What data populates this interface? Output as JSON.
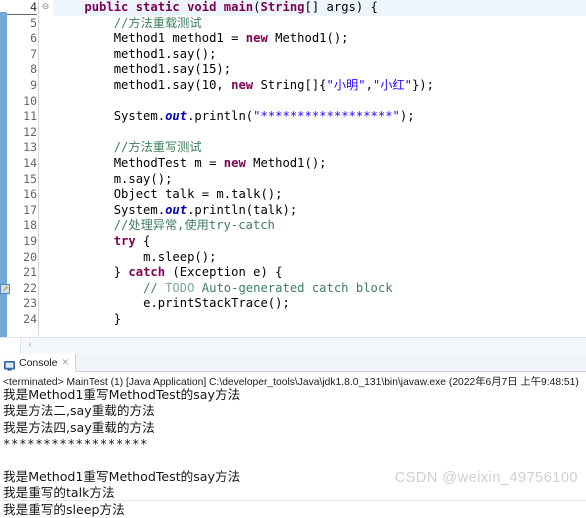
{
  "editor": {
    "first_line_number": 4,
    "current_line": 4,
    "fold_marker_glyph": "⊖",
    "warning_line": 22,
    "scroll_left_arrow": "‹",
    "lines": [
      {
        "n": 4,
        "indent": 1,
        "tokens": [
          {
            "t": "kw",
            "v": "public static void "
          },
          {
            "t": "kw",
            "v": "main"
          },
          {
            "t": "plain",
            "v": "("
          },
          {
            "t": "kw",
            "v": "String"
          },
          {
            "t": "plain",
            "v": "[] args) {"
          }
        ]
      },
      {
        "n": 5,
        "indent": 2,
        "tokens": [
          {
            "t": "cmt",
            "v": "//方法重载测试"
          }
        ]
      },
      {
        "n": 6,
        "indent": 2,
        "tokens": [
          {
            "t": "plain",
            "v": "Method1 method1 = "
          },
          {
            "t": "kw",
            "v": "new"
          },
          {
            "t": "plain",
            "v": " Method1();"
          }
        ]
      },
      {
        "n": 7,
        "indent": 2,
        "tokens": [
          {
            "t": "plain",
            "v": "method1.say();"
          }
        ]
      },
      {
        "n": 8,
        "indent": 2,
        "tokens": [
          {
            "t": "plain",
            "v": "method1.say(15);"
          }
        ]
      },
      {
        "n": 9,
        "indent": 2,
        "tokens": [
          {
            "t": "plain",
            "v": "method1.say(10, "
          },
          {
            "t": "kw",
            "v": "new"
          },
          {
            "t": "plain",
            "v": " String[]{"
          },
          {
            "t": "str",
            "v": "\"小明\""
          },
          {
            "t": "plain",
            "v": ","
          },
          {
            "t": "str",
            "v": "\"小红\""
          },
          {
            "t": "plain",
            "v": "});"
          }
        ]
      },
      {
        "n": 10,
        "indent": 0,
        "tokens": []
      },
      {
        "n": 11,
        "indent": 2,
        "tokens": [
          {
            "t": "plain",
            "v": "System."
          },
          {
            "t": "fld",
            "v": "out"
          },
          {
            "t": "plain",
            "v": ".println("
          },
          {
            "t": "str",
            "v": "\"******************\""
          },
          {
            "t": "plain",
            "v": ");"
          }
        ]
      },
      {
        "n": 12,
        "indent": 0,
        "tokens": []
      },
      {
        "n": 13,
        "indent": 2,
        "tokens": [
          {
            "t": "cmt",
            "v": "//方法重写测试"
          }
        ]
      },
      {
        "n": 14,
        "indent": 2,
        "tokens": [
          {
            "t": "plain",
            "v": "MethodTest m = "
          },
          {
            "t": "kw",
            "v": "new"
          },
          {
            "t": "plain",
            "v": " Method1();"
          }
        ]
      },
      {
        "n": 15,
        "indent": 2,
        "tokens": [
          {
            "t": "plain",
            "v": "m.say();"
          }
        ]
      },
      {
        "n": 16,
        "indent": 2,
        "tokens": [
          {
            "t": "plain",
            "v": "Object talk = m.talk();"
          }
        ]
      },
      {
        "n": 17,
        "indent": 2,
        "tokens": [
          {
            "t": "plain",
            "v": "System."
          },
          {
            "t": "fld",
            "v": "out"
          },
          {
            "t": "plain",
            "v": ".println(talk);"
          }
        ]
      },
      {
        "n": 18,
        "indent": 2,
        "tokens": [
          {
            "t": "cmt",
            "v": "//处理异常,使用try-catch"
          }
        ]
      },
      {
        "n": 19,
        "indent": 2,
        "tokens": [
          {
            "t": "kw",
            "v": "try"
          },
          {
            "t": "plain",
            "v": " {"
          }
        ]
      },
      {
        "n": 20,
        "indent": 3,
        "tokens": [
          {
            "t": "plain",
            "v": "m.sleep();"
          }
        ]
      },
      {
        "n": 21,
        "indent": 2,
        "tokens": [
          {
            "t": "plain",
            "v": "} "
          },
          {
            "t": "kw",
            "v": "catch"
          },
          {
            "t": "plain",
            "v": " (Exception e) {"
          }
        ]
      },
      {
        "n": 22,
        "indent": 3,
        "tokens": [
          {
            "t": "cmt",
            "v": "// "
          },
          {
            "t": "todo",
            "v": "TODO"
          },
          {
            "t": "cmt",
            "v": " Auto-generated catch block"
          }
        ]
      },
      {
        "n": 23,
        "indent": 3,
        "tokens": [
          {
            "t": "plain",
            "v": "e.printStackTrace();"
          }
        ]
      },
      {
        "n": 24,
        "indent": 2,
        "tokens": [
          {
            "t": "plain",
            "v": "}"
          }
        ]
      }
    ]
  },
  "console": {
    "tab_label": "Console",
    "tab_icon": "console-monitor-icon",
    "tab_close_glyph": "✕",
    "terminated_line": "<terminated> MainTest (1) [Java Application] C:\\developer_tools\\Java\\jdk1.8.0_131\\bin\\javaw.exe (2022年6月7日 上午9:48:51)",
    "output": [
      "我是Method1重写MethodTest的say方法",
      "我是方法二,say重载的方法",
      "我是方法四,say重载的方法",
      "******************",
      "",
      "我是Method1重写MethodTest的say方法",
      "我是重写的talk方法",
      "我是重写的sleep方法"
    ]
  },
  "watermark": {
    "text": "CSDN @weixin_49756100"
  },
  "colors": {
    "keyword": "#7f0055",
    "string": "#2a00ff",
    "comment": "#3f7f5f",
    "todo": "#7fa8a0",
    "field": "#0000c0",
    "current_line_bg": "#eef4fc",
    "ruler_blue": "#72a8d8"
  }
}
